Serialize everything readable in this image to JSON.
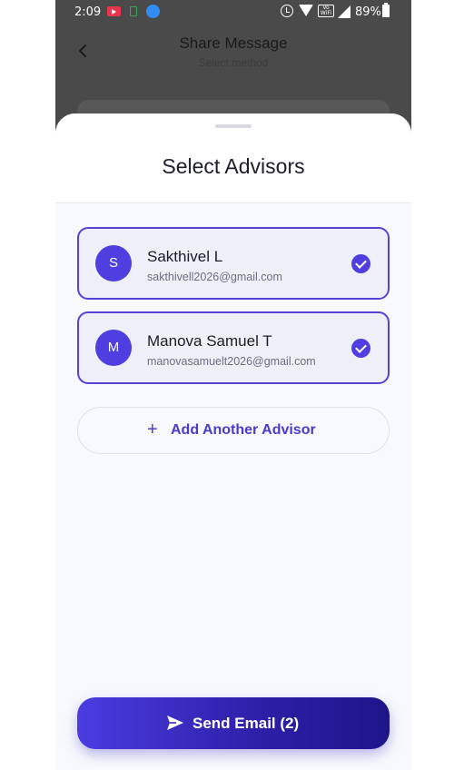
{
  "status_bar": {
    "time": "2:09",
    "battery": "89%",
    "vowifi_text": "Vo WiFi",
    "icons": [
      "youtube-icon",
      "book-icon",
      "app-icon",
      "alarm-icon",
      "wifi-icon",
      "vowifi-icon",
      "signal-icon",
      "battery-icon"
    ]
  },
  "background_header": {
    "title": "Share Message",
    "subtitle": "Select method",
    "back_icon": "chevron-left-icon"
  },
  "sheet": {
    "title": "Select Advisors",
    "advisors": [
      {
        "initial": "S",
        "name": "Sakthivel L",
        "email": "sakthivell2026@gmail.com",
        "selected": true
      },
      {
        "initial": "M",
        "name": "Manova Samuel T",
        "email": "manovasamuelt2026@gmail.com",
        "selected": true
      }
    ],
    "add_button": {
      "icon": "+",
      "label": "Add Another Advisor"
    },
    "send_button": {
      "label": "Send Email (2)",
      "icon": "send-icon"
    }
  },
  "colors": {
    "accent": "#4f3ee0",
    "accent_dark": "#1f158a",
    "card_bg": "#efeff9",
    "overlay": "#4a4a4a"
  }
}
